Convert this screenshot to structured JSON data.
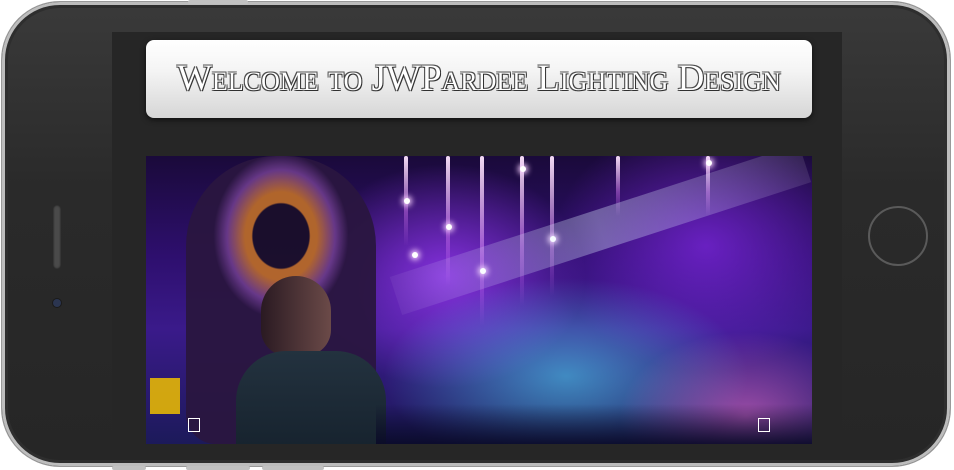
{
  "page": {
    "title": "Welcome to JWPardee Lighting Design"
  },
  "hero": {
    "description_icon": "stage-lighting-photo",
    "prev_icon": "prev-slide-icon",
    "next_icon": "next-slide-icon"
  },
  "colors": {
    "phone_body": "#2a2a2a",
    "screen_bg": "#262626",
    "banner_bg": "#f0f0f0",
    "accent_purple": "#7a2cff"
  }
}
